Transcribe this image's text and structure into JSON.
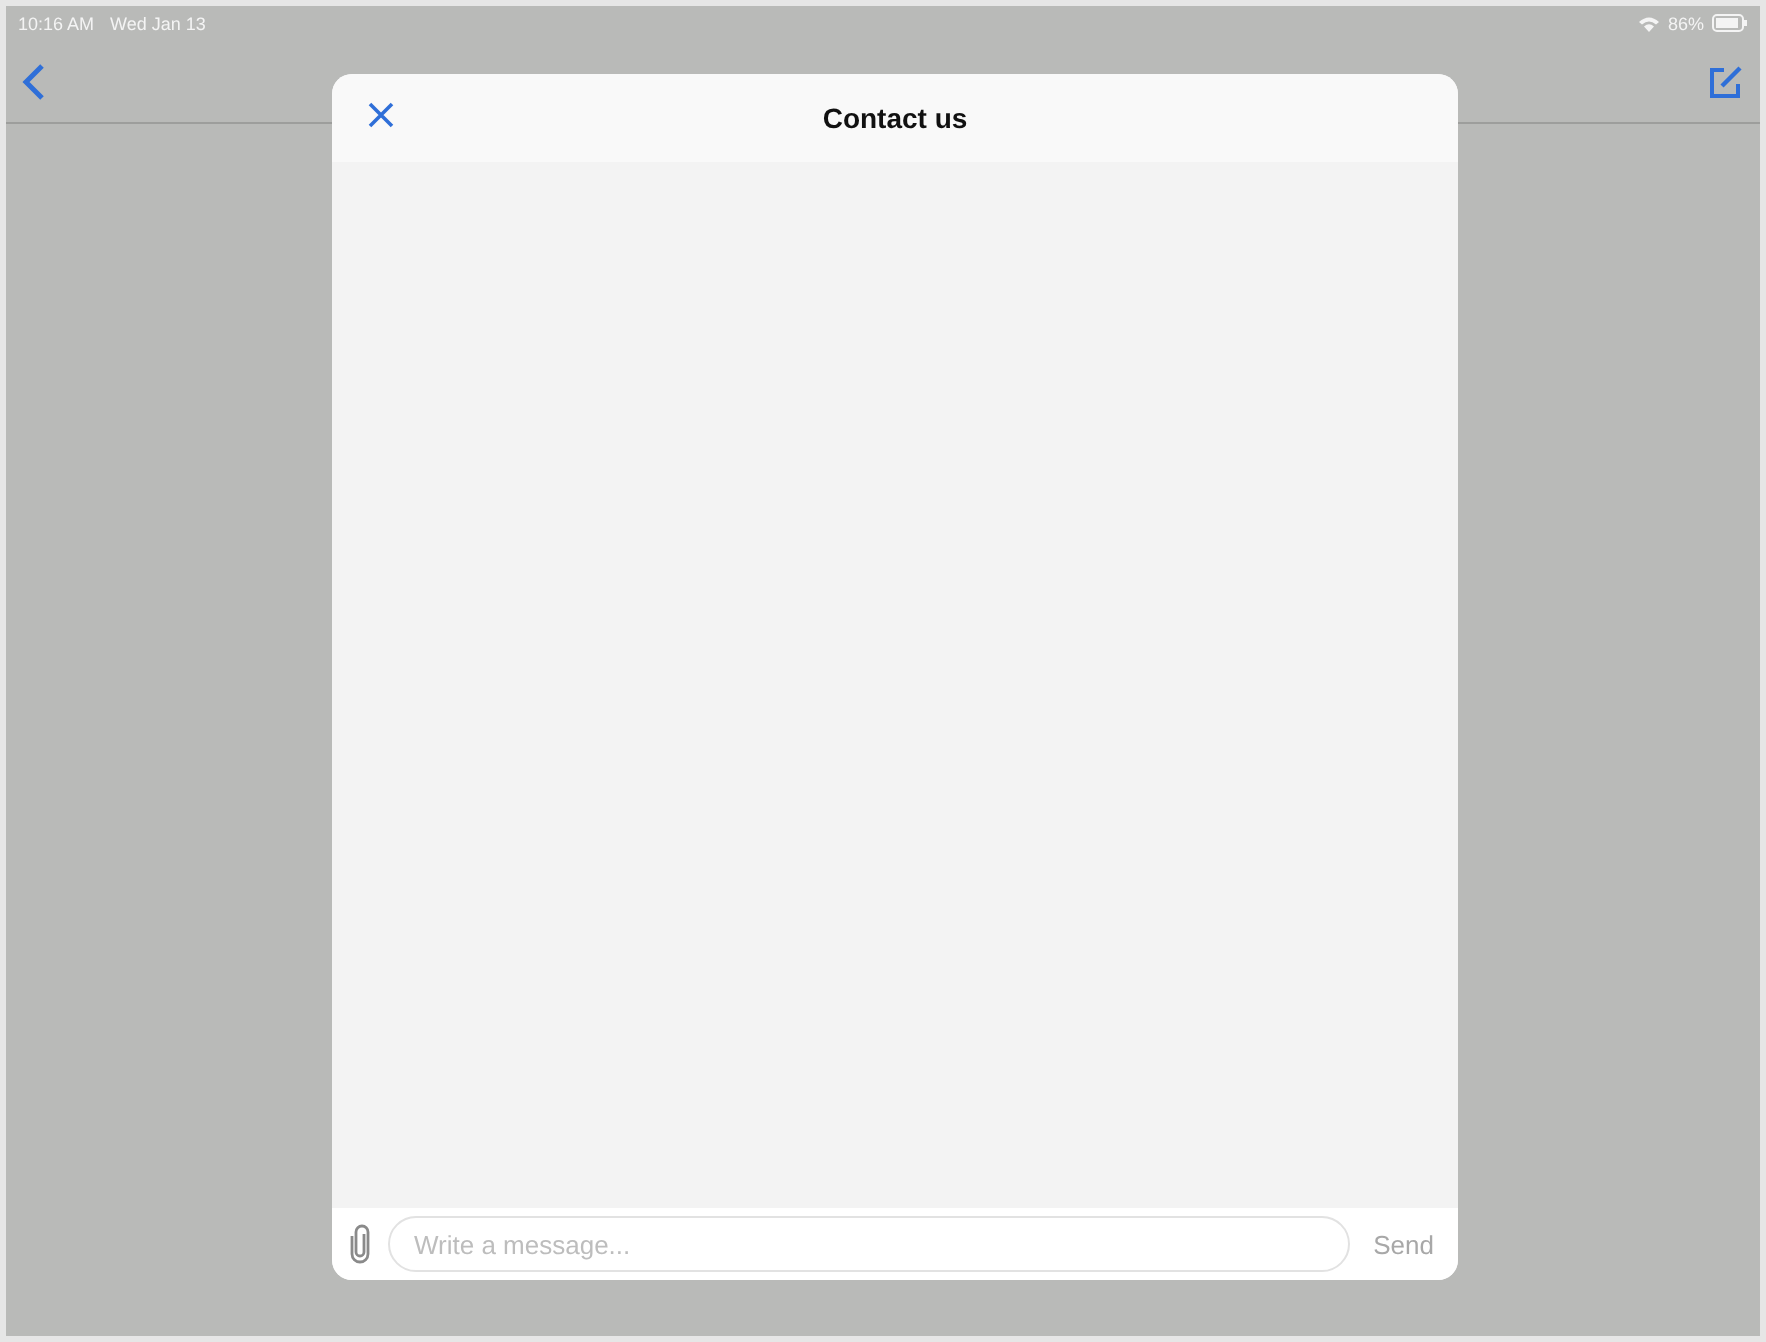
{
  "status_bar": {
    "time": "10:16 AM",
    "date": "Wed Jan 13",
    "battery": "86%"
  },
  "dialog": {
    "title": "Contact us",
    "composer": {
      "placeholder": "Write a message...",
      "send": {
        "label": "Send",
        "disabled": true
      }
    }
  }
}
